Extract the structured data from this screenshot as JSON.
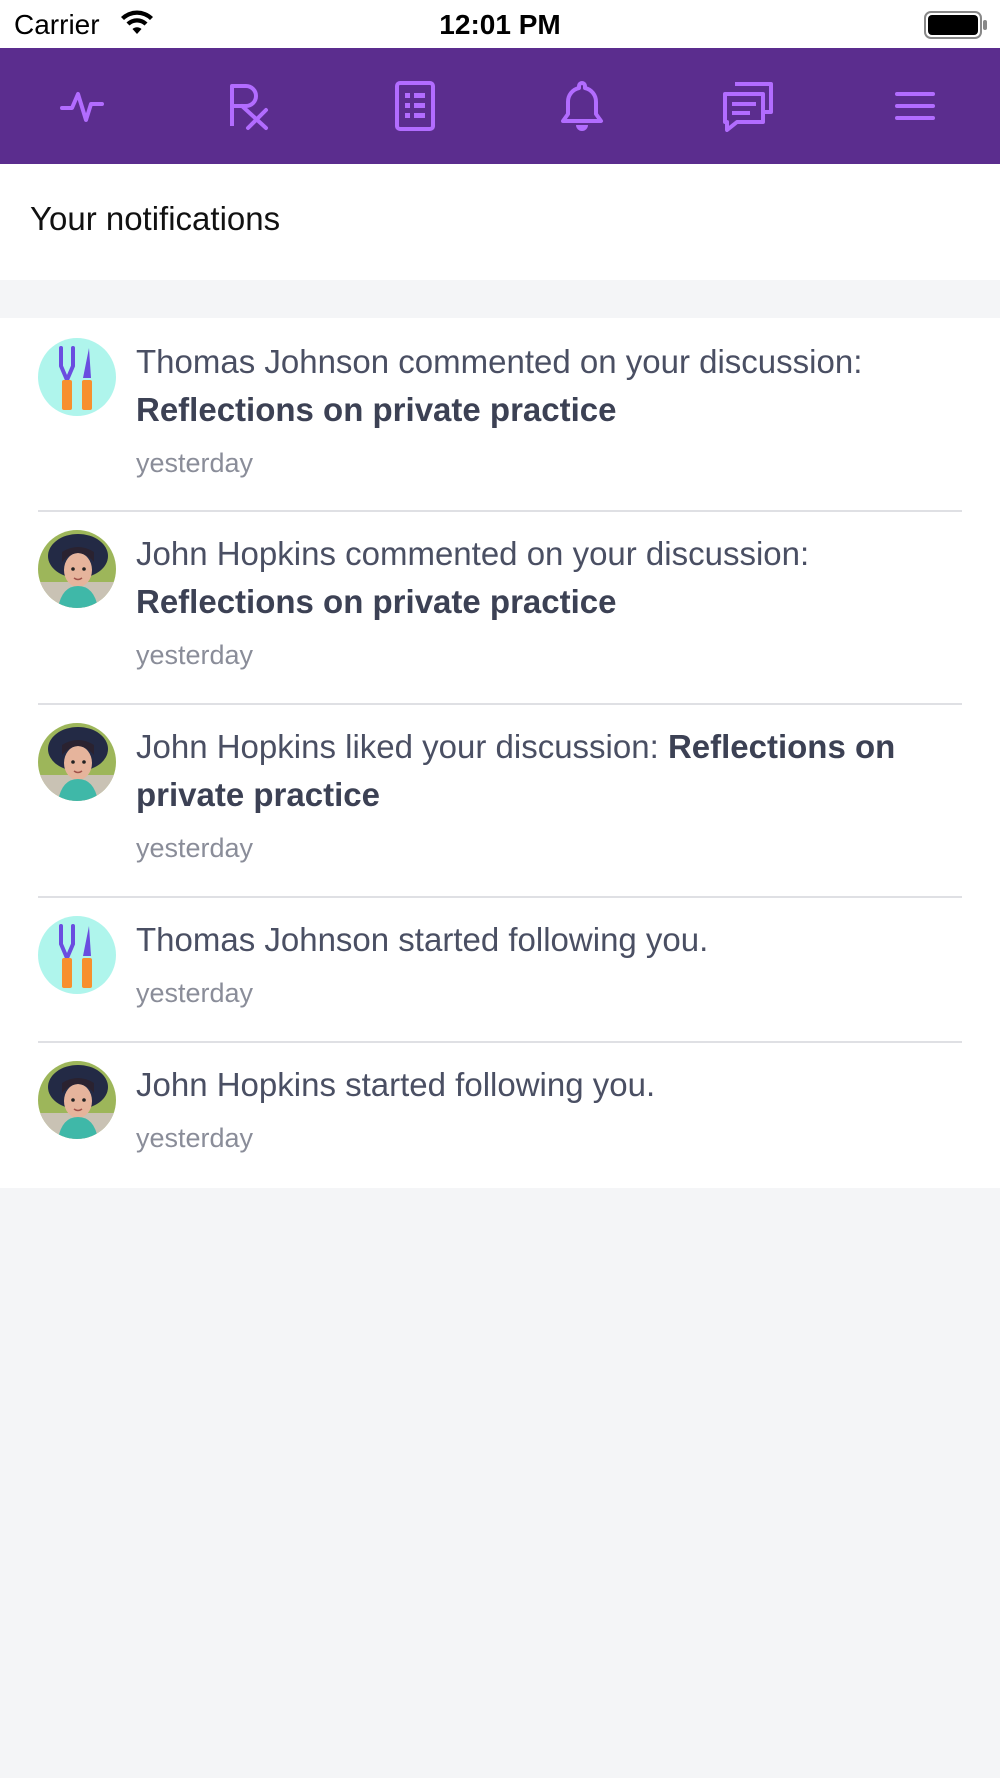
{
  "status_bar": {
    "carrier": "Carrier",
    "time": "12:01 PM"
  },
  "nav": {
    "icons": [
      "activity-icon",
      "prescription-icon",
      "document-icon",
      "bell-icon",
      "messages-icon",
      "menu-icon"
    ],
    "accent_color": "#5b2d8e",
    "icon_color": "#b26cff"
  },
  "header": {
    "title": "Your notifications"
  },
  "notifications": [
    {
      "avatar": "tools-avatar",
      "prefix": "Thomas Johnson commented on your discussion: ",
      "bold": "Reflections on private practice",
      "time": "yesterday"
    },
    {
      "avatar": "girl-photo-avatar",
      "prefix": "John Hopkins commented on your discussion: ",
      "bold": "Reflections on private practice",
      "time": "yesterday"
    },
    {
      "avatar": "girl-photo-avatar",
      "prefix": "John Hopkins liked your discussion: ",
      "bold": "Reflections on private practice",
      "time": "yesterday"
    },
    {
      "avatar": "tools-avatar",
      "prefix": "Thomas Johnson started following you.",
      "bold": "",
      "time": "yesterday"
    },
    {
      "avatar": "girl-photo-avatar",
      "prefix": "John Hopkins started following you.",
      "bold": "",
      "time": "yesterday"
    }
  ]
}
